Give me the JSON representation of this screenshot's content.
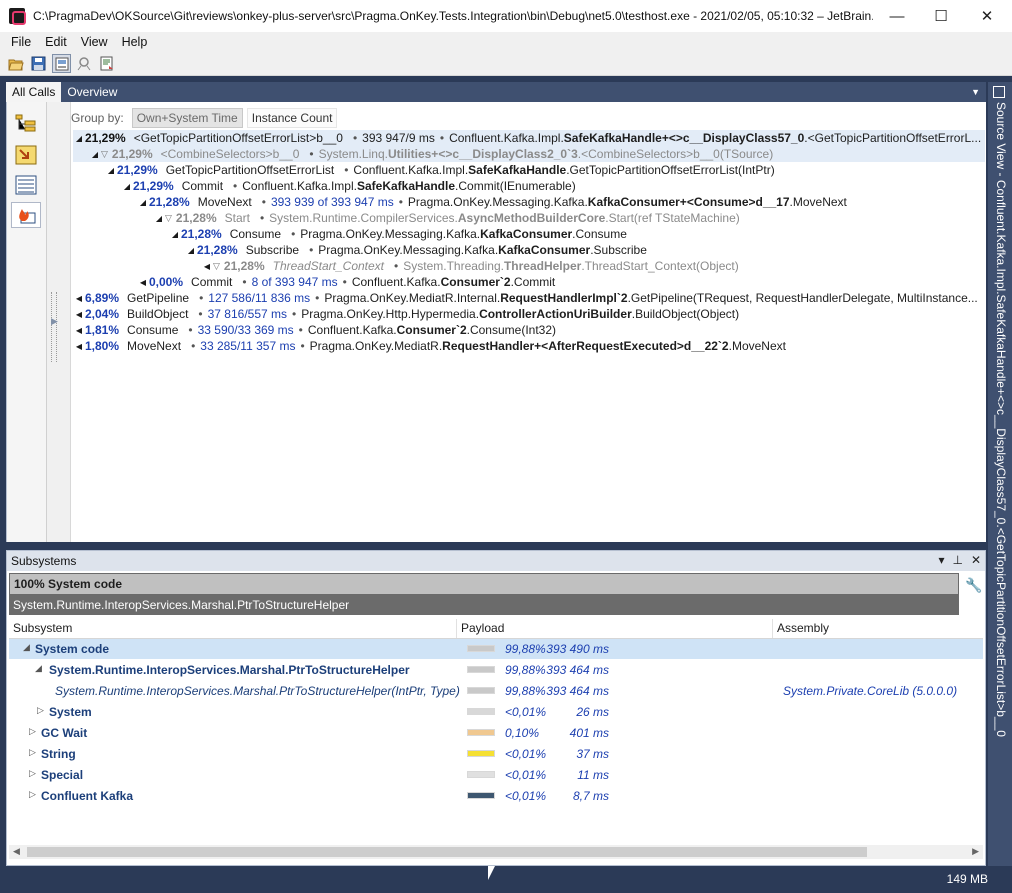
{
  "window": {
    "title": "C:\\PragmaDev\\OKSource\\Git\\reviews\\onkey-plus-server\\src\\Pragma.OnKey.Tests.Integration\\bin\\Debug\\net5.0\\testhost.exe - 2021/02/05, 05:10:32 – JetBrain...",
    "minimize": "—",
    "maximize": "☐",
    "close": "✕"
  },
  "menu": [
    "File",
    "Edit",
    "View",
    "Help"
  ],
  "tabs": [
    "All Calls",
    "Overview"
  ],
  "groupby": {
    "label": "Group by:",
    "options": [
      "Own+System Time",
      "Instance Count"
    ]
  },
  "tree": [
    {
      "pct": "21,29%",
      "name": "<GetTopicPartitionOffsetErrorList>b__0",
      "time": "393 947/9 ms",
      "ns": "Confluent.Kafka.Impl.",
      "cls": "SafeKafkaHandle+<>c__DisplayClass57_0",
      "rest": ".<GetTopicPartitionOffsetErrorL..."
    },
    {
      "pct": "21,29%",
      "name": "<CombineSelectors>b__0",
      "ns": "System.Linq.",
      "cls": "Utilities+<>c__DisplayClass2_0`3",
      "rest": ".<CombineSelectors>b__0(TSource)"
    },
    {
      "pct": "21,29%",
      "name": "GetTopicPartitionOffsetErrorList",
      "ns": "Confluent.Kafka.Impl.",
      "cls": "SafeKafkaHandle",
      "rest": ".GetTopicPartitionOffsetErrorList(IntPtr)"
    },
    {
      "pct": "21,29%",
      "name": "Commit",
      "ns": "Confluent.Kafka.Impl.",
      "cls": "SafeKafkaHandle",
      "rest": ".Commit(IEnumerable)"
    },
    {
      "pct": "21,28%",
      "name": "MoveNext",
      "time": "393 939 of 393 947 ms",
      "ns": "Pragma.OnKey.Messaging.Kafka.",
      "cls": "KafkaConsumer+<Consume>d__17",
      "rest": ".MoveNext"
    },
    {
      "pct": "21,28%",
      "name": "Start",
      "ns": "System.Runtime.CompilerServices.",
      "cls": "AsyncMethodBuilderCore",
      "rest": ".Start(ref TStateMachine)"
    },
    {
      "pct": "21,28%",
      "name": "Consume",
      "ns": "Pragma.OnKey.Messaging.Kafka.",
      "cls": "KafkaConsumer",
      "rest": ".Consume"
    },
    {
      "pct": "21,28%",
      "name": "Subscribe",
      "ns": "Pragma.OnKey.Messaging.Kafka.",
      "cls": "KafkaConsumer",
      "rest": ".Subscribe"
    },
    {
      "pct": "21,28%",
      "name": "ThreadStart_Context",
      "ns": "System.Threading.",
      "cls": "ThreadHelper",
      "rest": ".ThreadStart_Context(Object)"
    },
    {
      "pct": "0,00%",
      "name": "Commit",
      "time": "8 of 393 947 ms",
      "ns": "Confluent.Kafka.",
      "cls": "Consumer`2",
      "rest": ".Commit"
    },
    {
      "pct": "6,89%",
      "name": "GetPipeline",
      "time": "127 586/11 836 ms",
      "ns": "Pragma.OnKey.MediatR.Internal.",
      "cls": "RequestHandlerImpl`2",
      "rest": ".GetPipeline(TRequest, RequestHandlerDelegate, MultiInstance..."
    },
    {
      "pct": "2,04%",
      "name": "BuildObject",
      "time": "37 816/557 ms",
      "ns": "Pragma.OnKey.Http.Hypermedia.",
      "cls": "ControllerActionUriBuilder",
      "rest": ".BuildObject(Object)"
    },
    {
      "pct": "1,81%",
      "name": "Consume",
      "time": "33 590/33 369 ms",
      "ns": "Confluent.Kafka.",
      "cls": "Consumer`2",
      "rest": ".Consume(Int32)"
    },
    {
      "pct": "1,80%",
      "name": "MoveNext",
      "time": "33 285/11 357 ms",
      "ns": "Pragma.OnKey.MediatR.",
      "cls": "RequestHandler+<AfterRequestExecuted>d__22`2",
      "rest": ".MoveNext"
    }
  ],
  "right_panel": {
    "title": "Source View - Confluent.Kafka.Impl.SafeKafkaHandle+<>c__DisplayClass57_0.<GetTopicPartitionOffsetErrorList>b__0"
  },
  "subsystems": {
    "title": "Subsystems",
    "breadcrumb_top": "100% System code",
    "breadcrumb_bottom": "System.Runtime.InteropServices.Marshal.PtrToStructureHelper",
    "columns": [
      "Subsystem",
      "Payload",
      "Assembly"
    ],
    "rows": [
      {
        "name": "System code",
        "pct": "99,88%",
        "ms": "393 490 ms",
        "assembly": "",
        "bar_color": "#c9c9c9"
      },
      {
        "name": "System.Runtime.InteropServices.Marshal.PtrToStructureHelper",
        "pct": "99,88%",
        "ms": "393 464 ms",
        "assembly": "",
        "bar_color": "#c9c9c9"
      },
      {
        "name": "System.Runtime.InteropServices.Marshal.PtrToStructureHelper(IntPtr, Type)",
        "pct": "99,88%",
        "ms": "393 464 ms",
        "assembly": "System.Private.CoreLib (5.0.0.0)",
        "bar_color": "#c9c9c9"
      },
      {
        "name": "System",
        "pct": "<0,01%",
        "ms": "26 ms",
        "assembly": "",
        "bar_color": "#d8d8d8"
      },
      {
        "name": "GC Wait",
        "pct": "0,10%",
        "ms": "401 ms",
        "assembly": "",
        "bar_color": "#f0c890"
      },
      {
        "name": "String",
        "pct": "<0,01%",
        "ms": "37 ms",
        "assembly": "",
        "bar_color": "#f5e033"
      },
      {
        "name": "Special",
        "pct": "<0,01%",
        "ms": "11 ms",
        "assembly": "",
        "bar_color": "#e0e0e0"
      },
      {
        "name": "Confluent Kafka",
        "pct": "<0,01%",
        "ms": "8,7 ms",
        "assembly": "",
        "bar_color": "#3e5770"
      }
    ],
    "bar_fill_fractions": [
      1.0,
      1.0,
      1.0,
      0.0,
      0.0,
      0.0,
      0.0,
      0.0
    ]
  },
  "status": {
    "memory": "149 MB"
  },
  "icons": [
    "folder-open-icon",
    "save-icon",
    "snapshot-icon",
    "attach-icon",
    "export-icon",
    "flame-icon"
  ]
}
